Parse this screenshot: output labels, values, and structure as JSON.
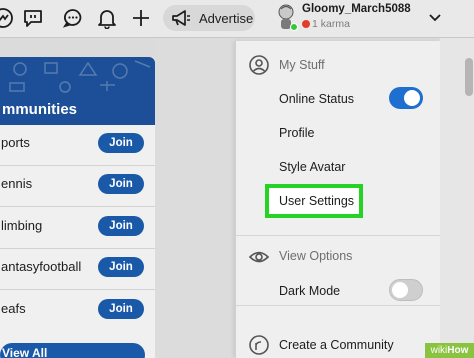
{
  "topbar": {
    "advertise_label": "Advertise",
    "username": "Gloomy_March5088",
    "karma": "1 karma",
    "icons": [
      "popular-icon",
      "chat-bubble-icon",
      "comments-icon",
      "notifications-bell-icon",
      "plus-icon",
      "megaphone-icon",
      "chevron-down-icon"
    ]
  },
  "communities": {
    "title": "mmunities",
    "items": [
      {
        "name": "ports",
        "join": "Join"
      },
      {
        "name": "ennis",
        "join": "Join"
      },
      {
        "name": "limbing",
        "join": "Join"
      },
      {
        "name": "antasyfootball",
        "join": "Join"
      },
      {
        "name": "eafs",
        "join": "Join"
      }
    ],
    "view_all": "View All"
  },
  "menu": {
    "my_stuff": "My Stuff",
    "online_status": "Online Status",
    "online_status_on": true,
    "profile": "Profile",
    "style_avatar": "Style Avatar",
    "user_settings": "User Settings",
    "view_options": "View Options",
    "dark_mode": "Dark Mode",
    "dark_mode_on": false,
    "create_community": "Create a Community"
  },
  "watermark": {
    "part1": "wiki",
    "part2": "How"
  },
  "colors": {
    "accent_blue": "#1a59a8",
    "toggle_on": "#1f6fd1",
    "highlight_green": "#26d226",
    "watermark_green": "#8ac33f"
  }
}
